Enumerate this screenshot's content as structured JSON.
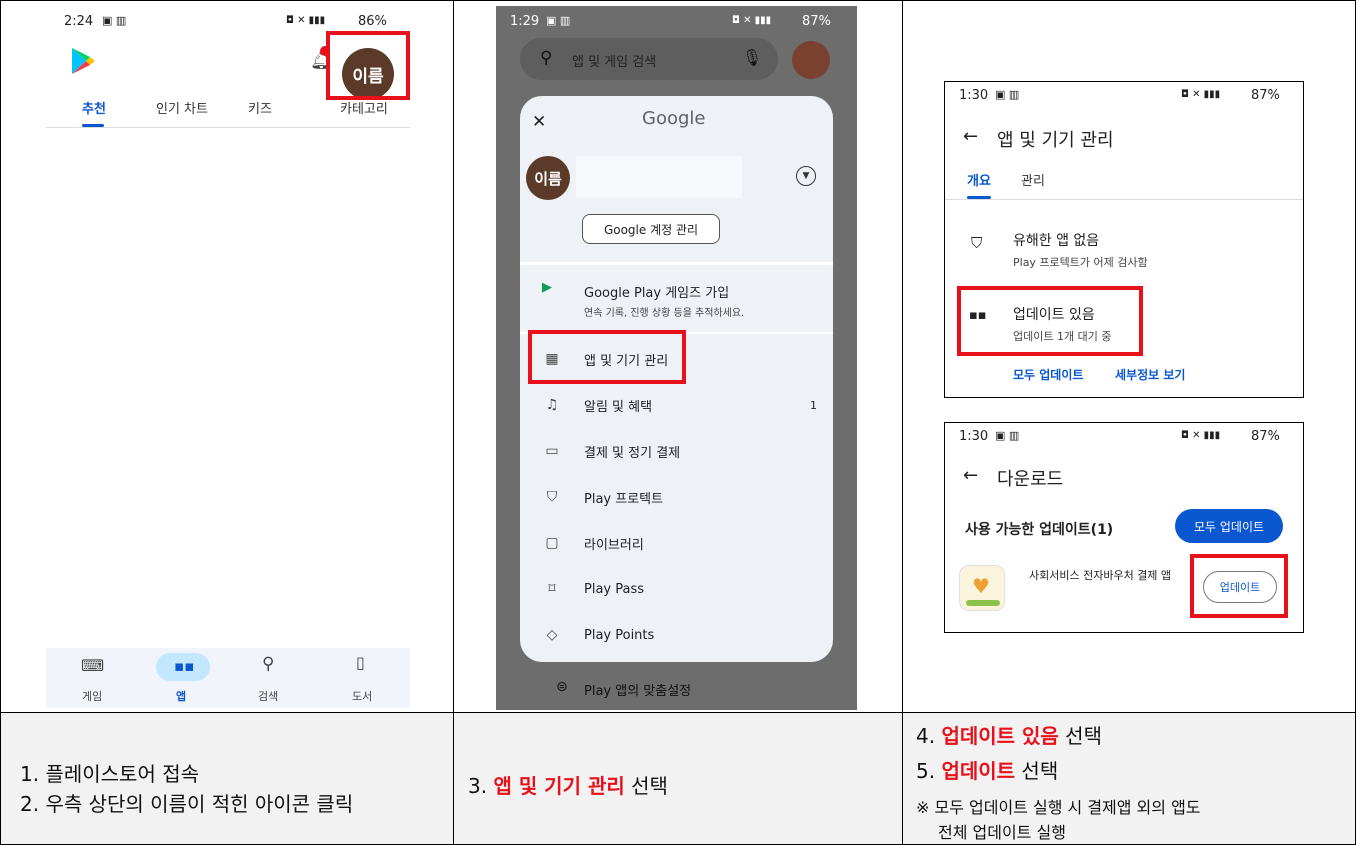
{
  "panel1": {
    "status_time": "2:24",
    "status_right": "86%",
    "avatar_name": "이름",
    "tabs": [
      "추천",
      "인기 차트",
      "키즈",
      "카테고리"
    ],
    "bottom_nav": [
      "게임",
      "앱",
      "검색",
      "도서"
    ]
  },
  "panel2": {
    "status_time": "1:29",
    "status_right": "87%",
    "search_placeholder": "앱 및 게임 검색",
    "sheet_title": "Google",
    "avatar_name": "이름",
    "manage_account": "Google 계정 관리",
    "games_title": "Google Play 게임즈 가입",
    "games_sub": "연속 기록, 진행 상황 등을 추적하세요.",
    "menu": [
      {
        "icon": "▦",
        "label": "앱 및 기기 관리",
        "count": ""
      },
      {
        "icon": "♫",
        "label": "알림 및 혜택",
        "count": "1"
      },
      {
        "icon": "▭",
        "label": "결제 및 정기 결제",
        "count": ""
      },
      {
        "icon": "⛉",
        "label": "Play 프로텍트",
        "count": ""
      },
      {
        "icon": "▢",
        "label": "라이브러리",
        "count": ""
      },
      {
        "icon": "⌑",
        "label": "Play Pass",
        "count": ""
      },
      {
        "icon": "◇",
        "label": "Play Points",
        "count": ""
      }
    ],
    "bottom_item": "Play 앱의 맞춤설정"
  },
  "panel3a": {
    "status_time": "1:30",
    "status_right": "87%",
    "title": "앱 및 기기 관리",
    "tabs": [
      "개요",
      "관리"
    ],
    "protect_title": "유해한 앱 없음",
    "protect_sub": "Play 프로텍트가 어제 검사함",
    "update_title": "업데이트 있음",
    "update_sub": "업데이트 1개 대기 중",
    "link_update_all": "모두 업데이트",
    "link_details": "세부정보 보기"
  },
  "panel3b": {
    "status_time": "1:30",
    "status_right": "87%",
    "title": "다운로드",
    "available": "사용 가능한 업데이트(1)",
    "update_all_btn": "모두 업데이트",
    "app_name": "사회서비스 전자바우처 결제 앱",
    "update_btn": "업데이트"
  },
  "captions": {
    "c1_line1": "1. 플레이스토어 접속",
    "c1_line2": "2. 우측 상단의 이름이 적힌 아이콘 클릭",
    "c2_prefix": "3. ",
    "c2_red": "앱 및 기기 관리",
    "c2_suffix": " 선택",
    "c3_l1_prefix": "4. ",
    "c3_l1_red": "업데이트 있음",
    "c3_l1_suffix": " 선택",
    "c3_l2_prefix": "5. ",
    "c3_l2_red": "업데이트",
    "c3_l2_suffix": " 선택",
    "c3_note1": "※ 모두 업데이트 실행 시 결제앱 외의 앱도",
    "c3_note2": "전체 업데이트 실행"
  },
  "colors": {
    "red_box": "#e8101a",
    "google_blue": "#0b57d0",
    "avatar_brown": "#5b3a29",
    "caption_bg": "#f2f2f2"
  }
}
